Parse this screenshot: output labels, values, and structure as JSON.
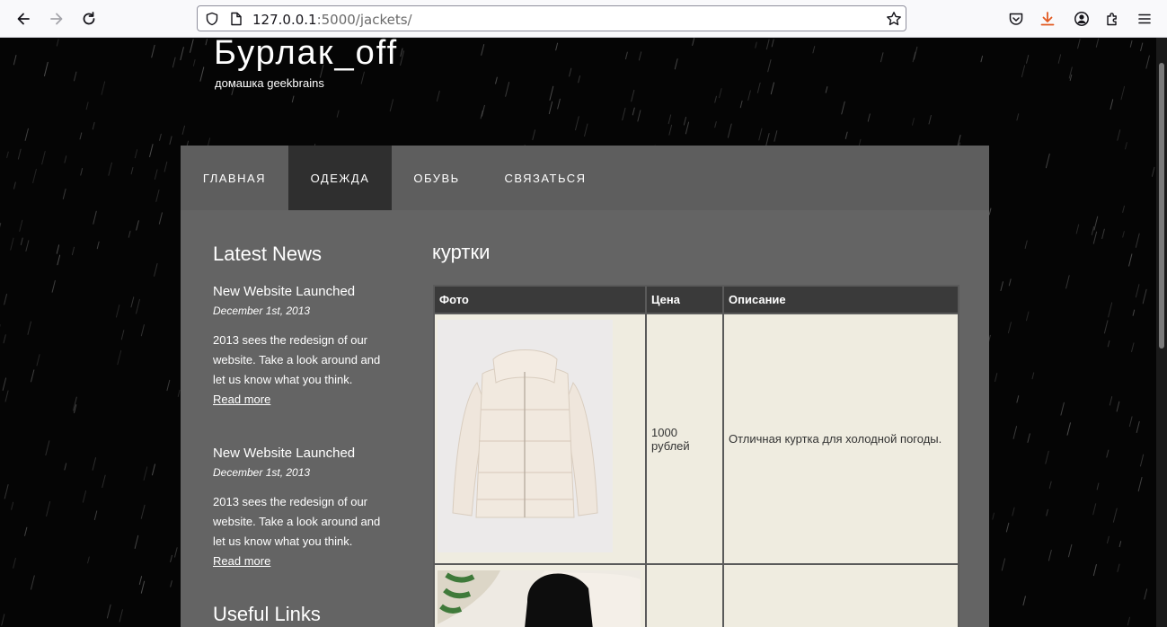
{
  "browser": {
    "url_host": "127.0.0.1",
    "url_rest": ":5000/jackets/"
  },
  "site": {
    "title": "Бурлак_off",
    "subtitle": "домашка geekbrains"
  },
  "menu": [
    {
      "label": "ГЛАВНАЯ",
      "active": false
    },
    {
      "label": "ОДЕЖДА",
      "active": true
    },
    {
      "label": "ОБУВЬ",
      "active": false
    },
    {
      "label": "СВЯЗАТЬСЯ",
      "active": false
    }
  ],
  "sidebar": {
    "latest_news_heading": "Latest News",
    "news": [
      {
        "title": "New Website Launched",
        "date": "December 1st, 2013",
        "body_lines": [
          "2013 sees the redesign of our",
          "website. Take a look around and",
          "let us know what you think."
        ],
        "more": "Read more"
      },
      {
        "title": "New Website Launched",
        "date": "December 1st, 2013",
        "body_lines": [
          "2013 sees the redesign of our",
          "website. Take a look around and",
          "let us know what you think."
        ],
        "more": "Read more"
      }
    ],
    "useful_links_heading": "Useful Links"
  },
  "main": {
    "title": "куртки",
    "table": {
      "headers": [
        "Фото",
        "Цена",
        "Описание"
      ],
      "rows": [
        {
          "price": "1000 рублей",
          "description": "Отличная куртка для холодной погоды."
        },
        {
          "price": "",
          "description": ""
        }
      ]
    }
  },
  "colors": {
    "menu_bg": "#5e5e5e",
    "menu_active": "#2f2f2f",
    "content_bg": "#646464",
    "table_header": "#3a3a3a",
    "table_cell": "#efece0",
    "download_icon": "#e25920"
  }
}
